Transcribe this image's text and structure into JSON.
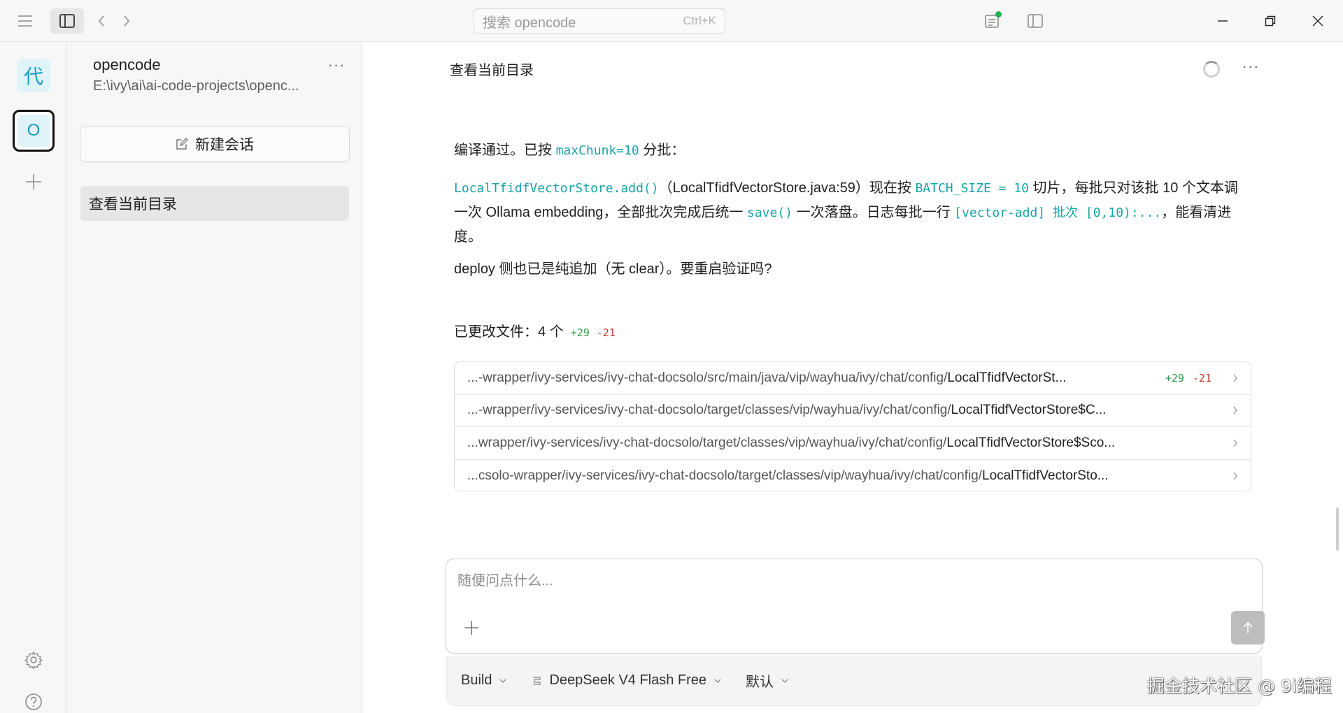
{
  "titlebar": {
    "search_placeholder": "搜索 opencode",
    "search_shortcut": "Ctrl+K",
    "review_status_color": "#1fb050"
  },
  "rail": {
    "projects": [
      {
        "label": "代",
        "selected": false
      },
      {
        "label": "O",
        "selected": true
      }
    ],
    "icons": [
      "plus-icon",
      "gear-icon",
      "help-icon"
    ]
  },
  "sidebar": {
    "project_name": "opencode",
    "project_path": "E:\\ivy\\ai\\ai-code-projects\\openc...",
    "new_session_label": "新建会话",
    "sessions": [
      {
        "title": "查看当前目录",
        "active": true
      }
    ]
  },
  "conversation": {
    "title": "查看当前目录",
    "message": {
      "p1_prefix": "编译通过。已按 ",
      "p1_code": "maxChunk=10",
      "p1_suffix": " 分批：",
      "p2_code1": "LocalTfidfVectorStore.add()",
      "p2_text1": "（LocalTfidfVectorStore.java:59）现在按 ",
      "p2_code2": "BATCH_SIZE = 10",
      "p2_text2": " 切片，每批只对该批 10 个文本调一次 Ollama embedding，全部批次完成后统一 ",
      "p2_code3": "save()",
      "p2_text3": " 一次落盘。日志每批一行 ",
      "p2_code4": "[vector-add] 批次 [0,10):...",
      "p2_text4": "，能看清进度。",
      "p3": "deploy 侧也已是纯追加（无 clear）。要重启验证吗?"
    },
    "changes": {
      "label": "已更改文件：",
      "count": "4 个",
      "added": "+29",
      "removed": "-21",
      "files": [
        {
          "dir": "...-wrapper/ivy-services/ivy-chat-docsolo/src/main/java/vip/wayhua/ivy/chat/config/",
          "name": "LocalTfidfVectorSt...",
          "added": "+29",
          "removed": "-21"
        },
        {
          "dir": "...-wrapper/ivy-services/ivy-chat-docsolo/target/classes/vip/wayhua/ivy/chat/config/",
          "name": "LocalTfidfVectorStore$C...",
          "added": "",
          "removed": ""
        },
        {
          "dir": "...wrapper/ivy-services/ivy-chat-docsolo/target/classes/vip/wayhua/ivy/chat/config/",
          "name": "LocalTfidfVectorStore$Sco...",
          "added": "",
          "removed": ""
        },
        {
          "dir": "...csolo-wrapper/ivy-services/ivy-chat-docsolo/target/classes/vip/wayhua/ivy/chat/config/",
          "name": "LocalTfidfVectorSto...",
          "added": "",
          "removed": ""
        }
      ]
    }
  },
  "composer": {
    "placeholder": "随便问点什么...",
    "agent": "Build",
    "model": "DeepSeek V4 Flash Free",
    "variant": "默认"
  },
  "watermark": "掘金技术社区 @ 9i编程",
  "colors": {
    "code": "#17a3a8",
    "added": "#2e9d45",
    "removed": "#c0392b"
  }
}
